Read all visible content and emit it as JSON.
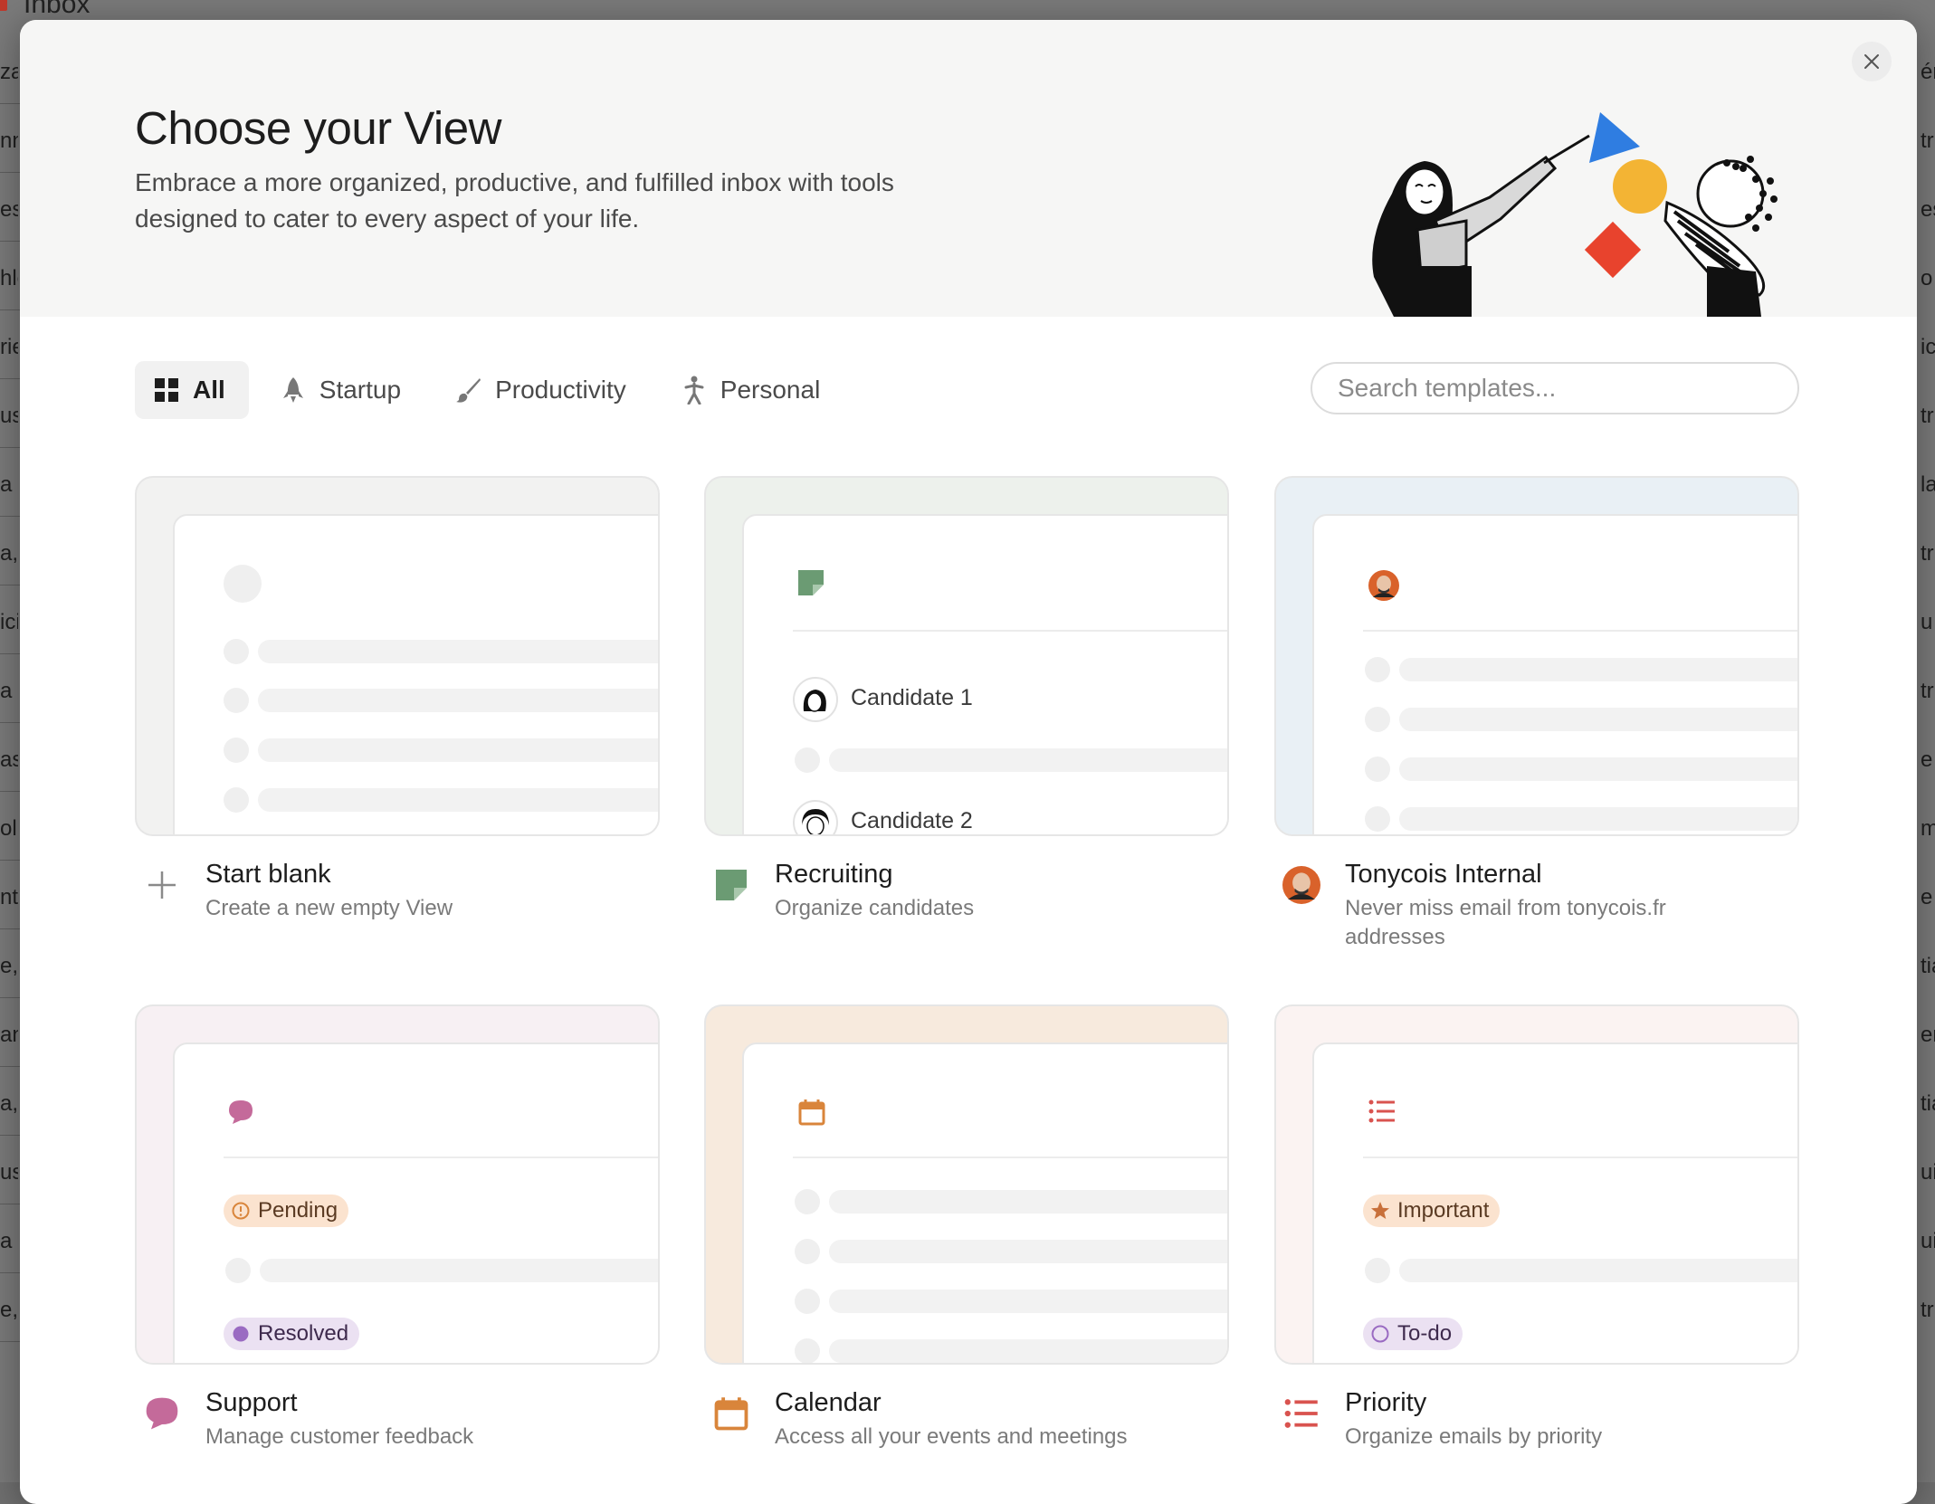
{
  "background": {
    "app_title": "Inbox",
    "left_fragments": [
      "za",
      "nn",
      "est",
      "hle",
      "rie",
      "ust",
      "a b",
      "a,",
      "ici",
      "a b",
      "as",
      "oll",
      "nt",
      "e,",
      "an",
      "a,",
      "ust",
      "a b",
      "e,"
    ],
    "right_fragments": [
      "ér",
      "tr",
      "est",
      "o",
      "ic",
      "tr",
      "la",
      "tr",
      "u p",
      "tr",
      "e",
      "m",
      "e",
      "tia",
      "er",
      "tia",
      "ui",
      "ui",
      "tr"
    ]
  },
  "modal": {
    "title": "Choose your View",
    "subtitle": "Embrace a more organized, productive, and fulfilled inbox with tools designed to cater to every aspect of your life.",
    "close_icon": "close-icon"
  },
  "filters": [
    {
      "label": "All",
      "icon": "grid-icon",
      "active": true
    },
    {
      "label": "Startup",
      "icon": "rocket-icon",
      "active": false
    },
    {
      "label": "Productivity",
      "icon": "brush-icon",
      "active": false
    },
    {
      "label": "Personal",
      "icon": "person-icon",
      "active": false
    }
  ],
  "search": {
    "placeholder": "Search templates..."
  },
  "colors": {
    "recruiting": "#6b9b73",
    "support": "#c46a9a",
    "calendar": "#d9853b",
    "priority": "#d9534f",
    "pending_bg": "#fbe3cf",
    "resolved_bg": "#ebe1f2",
    "important_bg": "#fbe3cf",
    "todo_bg": "#ebe1f2"
  },
  "templates": [
    {
      "title": "Start blank",
      "description": "Create a new empty View",
      "icon": "plus-icon"
    },
    {
      "title": "Recruiting",
      "description": "Organize candidates",
      "icon": "sticky-note-icon",
      "preview": {
        "rows": [
          "Candidate 1",
          "Candidate 2"
        ]
      }
    },
    {
      "title": "Tonycois Internal",
      "description": "Never miss email from tonycois.fr addresses",
      "icon": "avatar-icon"
    },
    {
      "title": "Support",
      "description": "Manage customer feedback",
      "icon": "chat-bubble-icon",
      "preview": {
        "tags": [
          "Pending",
          "Resolved"
        ]
      }
    },
    {
      "title": "Calendar",
      "description": "Access all your events and meetings",
      "icon": "calendar-icon"
    },
    {
      "title": "Priority",
      "description": "Organize emails by priority",
      "icon": "list-icon",
      "preview": {
        "tags": [
          "Important",
          "To-do"
        ]
      }
    }
  ]
}
